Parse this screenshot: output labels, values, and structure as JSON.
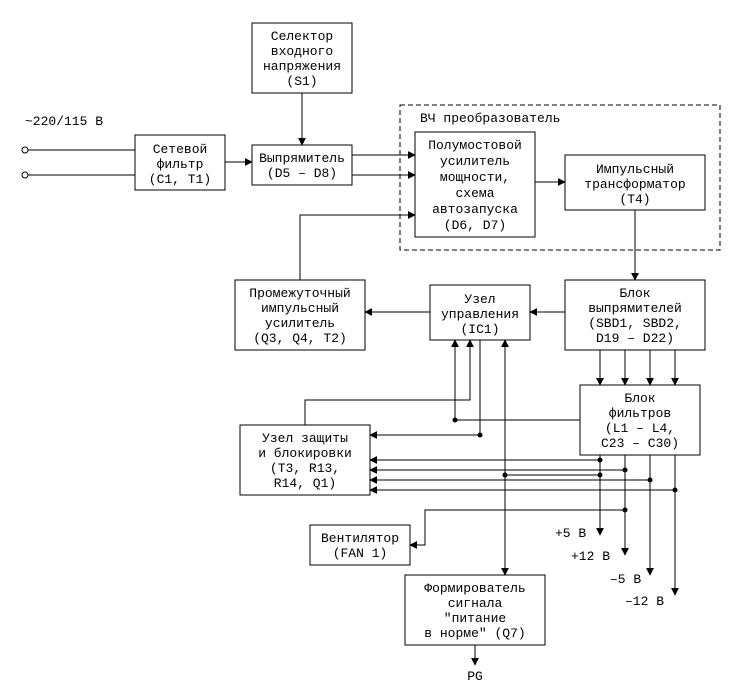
{
  "input_label": "~220/115 В",
  "blocks": {
    "selector": {
      "l1": "Селектор",
      "l2": "входного",
      "l3": "напряжения",
      "l4": "(S1)"
    },
    "filter": {
      "l1": "Сетевой",
      "l2": "фильтр",
      "l3": "(C1, T1)"
    },
    "rectifier": {
      "l1": "Выпрямитель",
      "l2": "(D5 – D8)"
    },
    "hf_group": {
      "label": "ВЧ преобразователь"
    },
    "halfbridge": {
      "l1": "Полумостовой",
      "l2": "усилитель",
      "l3": "мощности,",
      "l4": "схема",
      "l5": "автозапуска",
      "l6": "(D6, D7)"
    },
    "xfmr": {
      "l1": "Импульсный",
      "l2": "трансформатор",
      "l3": "(T4)"
    },
    "interamp": {
      "l1": "Промежуточный",
      "l2": "импульсный",
      "l3": "усилитель",
      "l4": "(Q3, Q4, T2)"
    },
    "ctrl": {
      "l1": "Узел",
      "l2": "управления",
      "l3": "(IC1)"
    },
    "rectblock": {
      "l1": "Блок",
      "l2": "выпрямителей",
      "l3": "(SBD1, SBD2,",
      "l4": "D19 – D22)"
    },
    "filtblock": {
      "l1": "Блок",
      "l2": "фильтров",
      "l3": "(L1 – L4,",
      "l4": "C23 – C30)"
    },
    "protect": {
      "l1": "Узел защиты",
      "l2": "и блокировки",
      "l3": "(T3, R13,",
      "l4": "R14, Q1)"
    },
    "fan": {
      "l1": "Вентилятор",
      "l2": "(FAN 1)"
    },
    "pg": {
      "l1": "Формирователь",
      "l2": "сигнала",
      "l3": "\"питание",
      "l4": "в норме\"  (Q7)"
    }
  },
  "outputs": {
    "p5": "+5 В",
    "p12": "+12 В",
    "n5": "–5 В",
    "n12": "–12 В",
    "pg": "PG"
  }
}
